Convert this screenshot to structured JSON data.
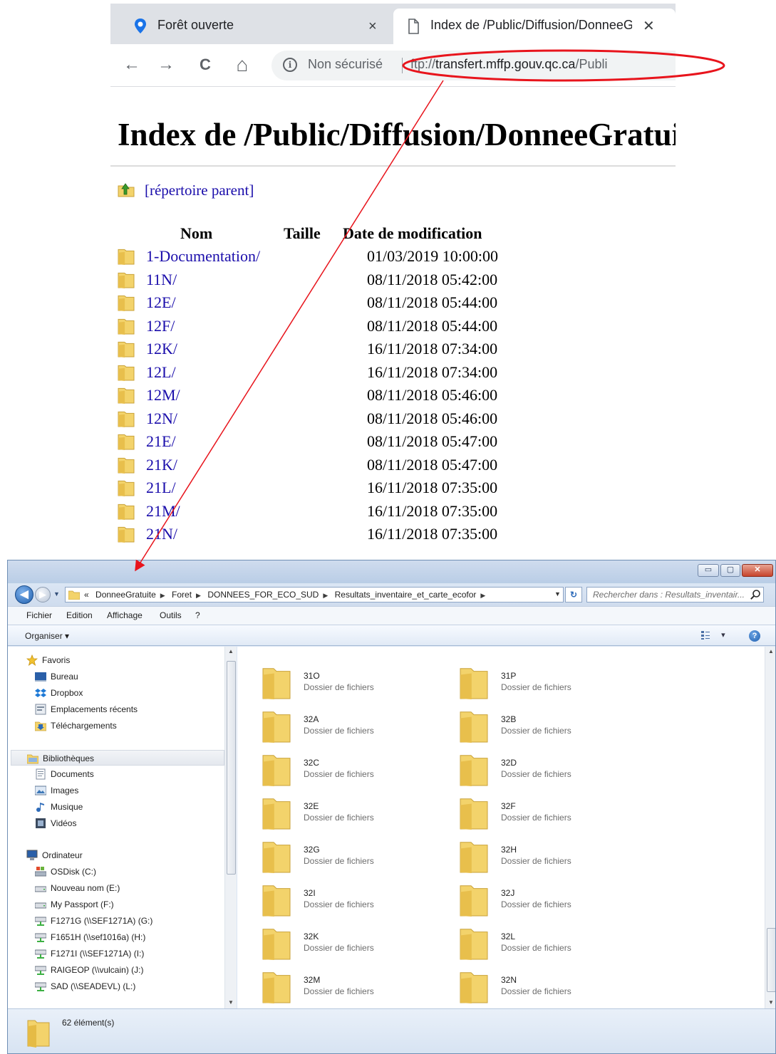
{
  "browser": {
    "tabs": [
      {
        "title": "Forêt ouverte",
        "close": "×"
      },
      {
        "title": "Index de /Public/Diffusion/DonneeGratuite",
        "close": "✕"
      }
    ],
    "nav": {
      "back": "←",
      "forward": "→",
      "reload": "C",
      "home": "⌂"
    },
    "omnibox": {
      "info": "i",
      "security_label": "Non sécurisé",
      "url_scheme": "ftp://",
      "url_host": "transfert.mffp.gouv.qc.ca",
      "url_path": "/Publi"
    },
    "page": {
      "heading": "Index de /Public/Diffusion/DonneeGratuite",
      "parent_link": "[répertoire parent]",
      "columns": {
        "name": "Nom",
        "size": "Taille",
        "date": "Date de modification"
      },
      "entries": [
        {
          "name": "1-Documentation/",
          "date": "01/03/2019 10:00:00"
        },
        {
          "name": "11N/",
          "date": "08/11/2018 05:42:00"
        },
        {
          "name": "12E/",
          "date": "08/11/2018 05:44:00"
        },
        {
          "name": "12F/",
          "date": "08/11/2018 05:44:00"
        },
        {
          "name": "12K/",
          "date": "16/11/2018 07:34:00"
        },
        {
          "name": "12L/",
          "date": "16/11/2018 07:34:00"
        },
        {
          "name": "12M/",
          "date": "08/11/2018 05:46:00"
        },
        {
          "name": "12N/",
          "date": "08/11/2018 05:46:00"
        },
        {
          "name": "21E/",
          "date": "08/11/2018 05:47:00"
        },
        {
          "name": "21K/",
          "date": "08/11/2018 05:47:00"
        },
        {
          "name": "21L/",
          "date": "16/11/2018 07:35:00"
        },
        {
          "name": "21M/",
          "date": "16/11/2018 07:35:00"
        },
        {
          "name": "21N/",
          "date": "16/11/2018 07:35:00"
        }
      ]
    }
  },
  "explorer": {
    "window_buttons": {
      "minimize": "▭",
      "maximize": "▢",
      "close": "✕"
    },
    "nav": {
      "back": "◀",
      "forward": "▶",
      "dropdown": "▼"
    },
    "breadcrumb": {
      "overflow": "«",
      "items": [
        "DonneeGratuite",
        "Foret",
        "DONNEES_FOR_ECO_SUD",
        "Resultats_inventaire_et_carte_ecofor"
      ],
      "separator": "▶"
    },
    "address_dropdown": "▼",
    "refresh": "↻",
    "search_placeholder": "Rechercher dans : Resultats_inventair...",
    "menu": [
      "Fichier",
      "Edition",
      "Affichage",
      "Outils",
      "?"
    ],
    "organize": "Organiser ▾",
    "views": "▾",
    "help": "?",
    "nav_pane": {
      "favorites": {
        "label": "Favoris",
        "items": [
          "Bureau",
          "Dropbox",
          "Emplacements récents",
          "Téléchargements"
        ]
      },
      "libraries": {
        "label": "Bibliothèques",
        "items": [
          "Documents",
          "Images",
          "Musique",
          "Vidéos"
        ]
      },
      "computer": {
        "label": "Ordinateur",
        "items": [
          "OSDisk (C:)",
          "Nouveau nom (E:)",
          "My Passport (F:)",
          "F1271G (\\\\SEF1271A) (G:)",
          "F1651H (\\\\sef1016a) (H:)",
          "F1271I (\\\\SEF1271A) (I:)",
          "RAIGEOP (\\\\vulcain) (J:)",
          "SAD (\\\\SEADEVL) (L:)"
        ]
      }
    },
    "folders": [
      {
        "name": "31O",
        "type": "Dossier de fichiers"
      },
      {
        "name": "31P",
        "type": "Dossier de fichiers"
      },
      {
        "name": "32A",
        "type": "Dossier de fichiers"
      },
      {
        "name": "32B",
        "type": "Dossier de fichiers"
      },
      {
        "name": "32C",
        "type": "Dossier de fichiers"
      },
      {
        "name": "32D",
        "type": "Dossier de fichiers"
      },
      {
        "name": "32E",
        "type": "Dossier de fichiers"
      },
      {
        "name": "32F",
        "type": "Dossier de fichiers"
      },
      {
        "name": "32G",
        "type": "Dossier de fichiers"
      },
      {
        "name": "32H",
        "type": "Dossier de fichiers"
      },
      {
        "name": "32I",
        "type": "Dossier de fichiers"
      },
      {
        "name": "32J",
        "type": "Dossier de fichiers"
      },
      {
        "name": "32K",
        "type": "Dossier de fichiers"
      },
      {
        "name": "32L",
        "type": "Dossier de fichiers"
      },
      {
        "name": "32M",
        "type": "Dossier de fichiers"
      },
      {
        "name": "32N",
        "type": "Dossier de fichiers"
      }
    ],
    "status_count": "62 élément(s)"
  },
  "colors": {
    "annotation_red": "#e8141c",
    "link_blue": "#1a0dab",
    "folder_yellow": "#f3d36b"
  }
}
